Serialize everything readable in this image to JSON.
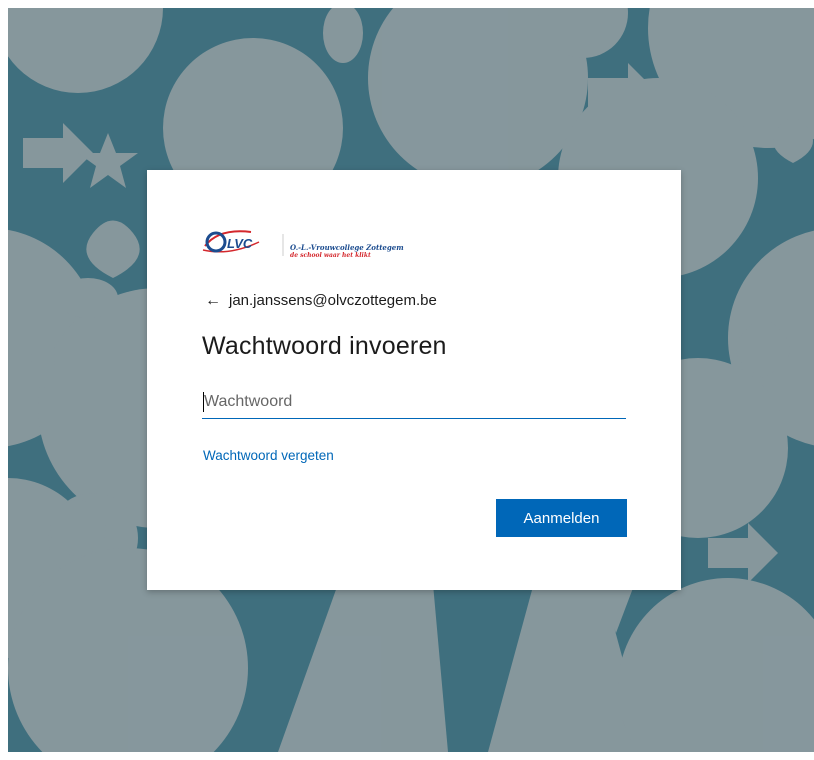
{
  "colors": {
    "background": "#3f6f7e",
    "background_icons": "#9aa3a5",
    "accent": "#0067b8",
    "logo_blue": "#1c4c8f",
    "logo_red": "#d4282d"
  },
  "logo": {
    "mark_text": "LVC",
    "line1": "O.-L.-Vrouwcollege Zottegem",
    "line2": "de school waar het klikt"
  },
  "account": {
    "back_icon": "arrow-left-icon",
    "email": "jan.janssens@olvczottegem.be"
  },
  "form": {
    "title": "Wachtwoord invoeren",
    "password_value": "",
    "password_placeholder": "Wachtwoord",
    "forgot_link": "Wachtwoord vergeten",
    "submit_label": "Aanmelden"
  }
}
